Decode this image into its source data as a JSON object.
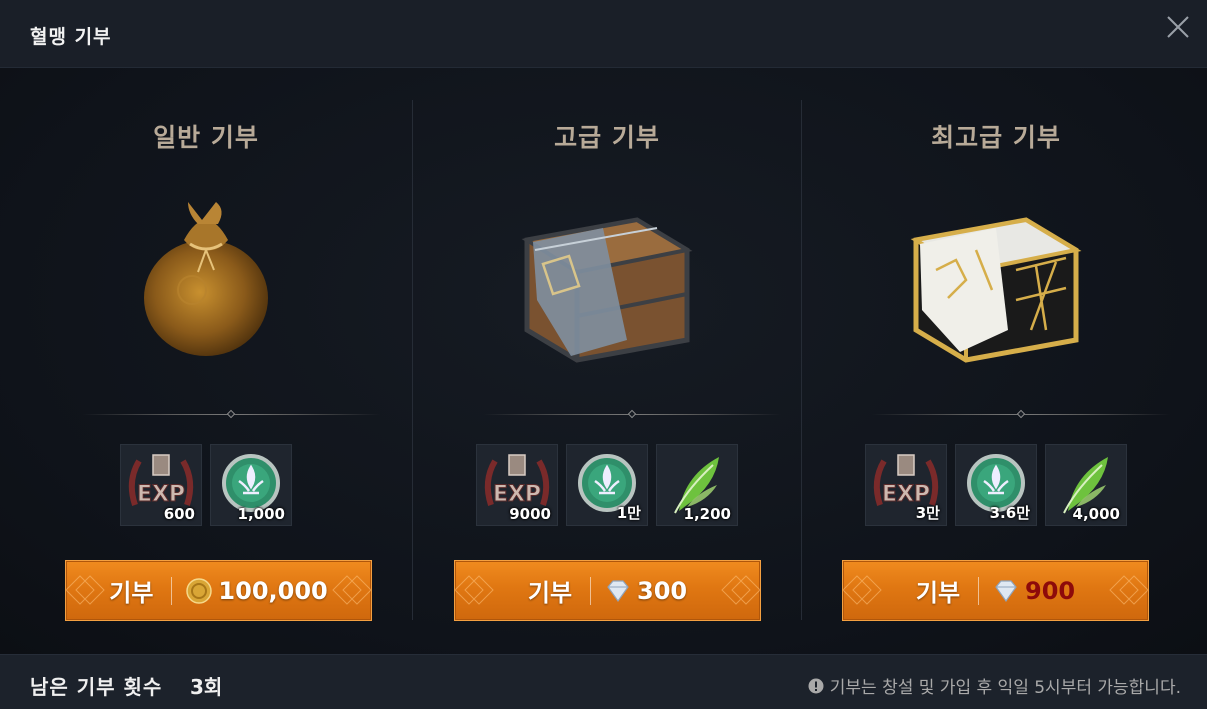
{
  "window": {
    "title": "혈맹 기부",
    "close_icon": "close-icon"
  },
  "tiers": [
    {
      "title": "일반 기부",
      "item": "pouch",
      "rewards": [
        {
          "icon": "exp-icon",
          "qty": "600"
        },
        {
          "icon": "fleur-coin-icon",
          "qty": "1,000"
        }
      ],
      "button": {
        "label": "기부",
        "currency_icon": "gold-coin-icon",
        "price": "100,000",
        "affordable": true
      }
    },
    {
      "title": "고급 기부",
      "item": "wooden-chest",
      "rewards": [
        {
          "icon": "exp-icon",
          "qty": "9000"
        },
        {
          "icon": "fleur-coin-icon",
          "qty": "1만"
        },
        {
          "icon": "feather-icon",
          "qty": "1,200"
        }
      ],
      "button": {
        "label": "기부",
        "currency_icon": "diamond-icon",
        "price": "300",
        "affordable": true
      }
    },
    {
      "title": "최고급 기부",
      "item": "golden-chest",
      "rewards": [
        {
          "icon": "exp-icon",
          "qty": "3만"
        },
        {
          "icon": "fleur-coin-icon",
          "qty": "3.6만"
        },
        {
          "icon": "feather-icon",
          "qty": "4,000"
        }
      ],
      "button": {
        "label": "기부",
        "currency_icon": "diamond-icon",
        "price": "900",
        "affordable": false
      }
    }
  ],
  "footer": {
    "remaining_label": "남은 기부 횟수",
    "remaining_value": "3회",
    "notice": "기부는 창설 및 가입 후 익일 5시부터 가능합니다."
  },
  "colors": {
    "button_orange": "#e07712",
    "insufficient_red": "#8d0a0a",
    "title_tan": "#b8aa98"
  }
}
